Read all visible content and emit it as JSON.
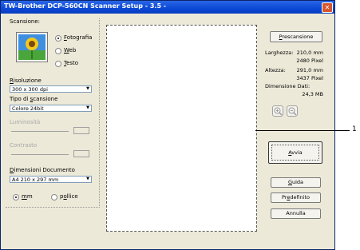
{
  "window": {
    "title": "TW-Brother DCP-560CN Scanner Setup - 3.5 -"
  },
  "scan": {
    "label": "Scansione:",
    "options": [
      {
        "label": "Fotografia",
        "underline": "F",
        "selected": true
      },
      {
        "label": "Web",
        "underline": "W",
        "selected": false
      },
      {
        "label": "Testo",
        "underline": "T",
        "selected": false
      }
    ]
  },
  "resolution": {
    "label": "Risoluzione",
    "value": "300 x 300 dpi"
  },
  "scan_type": {
    "label": "Tipo di scansione",
    "value": "Colore 24bit"
  },
  "brightness": {
    "label": "Luminosità"
  },
  "contrast": {
    "label": "Contrasto"
  },
  "document_size": {
    "label": "Dimensioni Documento",
    "value": "A4 210 x 297 mm"
  },
  "units": {
    "mm": "mm",
    "inch": "pollice",
    "selected": "mm"
  },
  "buttons": {
    "prescan": "Prescansione",
    "start": "Avvia",
    "help": "Guida",
    "default": "Predefinito",
    "cancel": "Annulla"
  },
  "info": {
    "width_label": "Larghezza:",
    "width_mm": "210,0 mm",
    "width_px": "2480 Pixel",
    "height_label": "Altezza:",
    "height_mm": "291,0 mm",
    "height_px": "3437 Pixel",
    "data_size_label": "Dimensione Dati:",
    "data_size_value": "24,3 MB"
  },
  "callout": {
    "number": "1"
  },
  "colors": {
    "titlebar": "#0b48d6",
    "window_bg": "#ece9d8",
    "close": "#d7562e"
  }
}
